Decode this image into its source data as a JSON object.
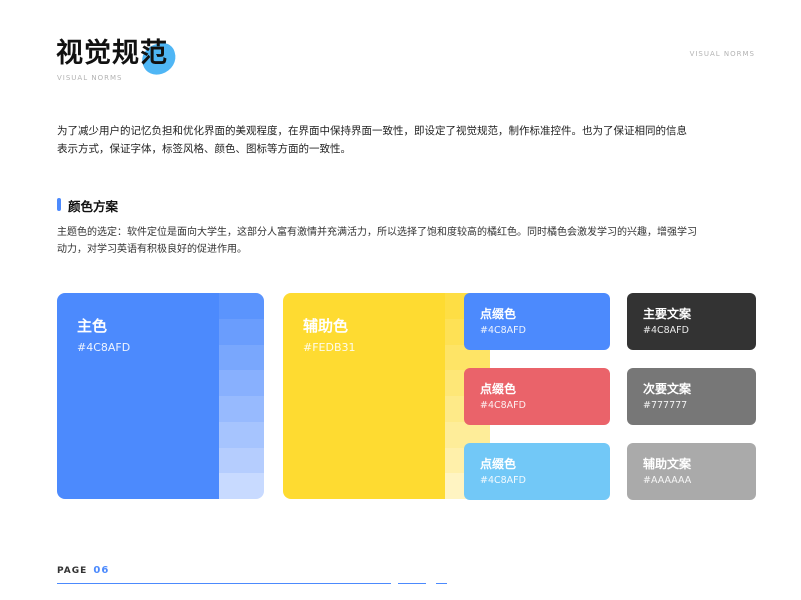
{
  "header": {
    "title": "视觉规范",
    "subtitle_en": "VISUAL NORMS",
    "corner_label": "VISUAL NORMS"
  },
  "intro": "为了减少用户的记忆负担和优化界面的美观程度，在界面中保持界面一致性，即设定了视觉规范，制作标准控件。也为了保证相同的信息表示方式，保证字体，标签风格、颜色、图标等方面的一致性。",
  "section": {
    "title": "颜色方案",
    "description": "主题色的选定：软件定位是面向大学生，这部分人富有激情并充满活力，所以选择了饱和度较高的橘红色。同时橘色会激发学习的兴趣，增强学习动力，对学习英语有积极良好的促进作用。"
  },
  "colors": {
    "primary": {
      "name": "主色",
      "hex": "#4C8AFD",
      "color": "#4c8afd",
      "shades": [
        "#5b94fd",
        "#6a9dfd",
        "#79a7fd",
        "#88b0fe",
        "#97bafe",
        "#a6c4fe",
        "#b5cdfe",
        "#c8daff"
      ]
    },
    "secondary": {
      "name": "辅助色",
      "hex": "#FEDB31",
      "color": "#fedb31",
      "shades": [
        "#fede44",
        "#fee155",
        "#fee466",
        "#fee777",
        "#feea88",
        "#feed99",
        "#fff0aa",
        "#fff4c2"
      ]
    },
    "accents": [
      {
        "name": "点缀色",
        "hex": "#4C8AFD",
        "color": "#4c8afd"
      },
      {
        "name": "点缀色",
        "hex": "#4C8AFD",
        "color": "#ea636a"
      },
      {
        "name": "点缀色",
        "hex": "#4C8AFD",
        "color": "#72c8f7"
      }
    ],
    "text": [
      {
        "name": "主要文案",
        "hex": "#4C8AFD",
        "color": "#333333"
      },
      {
        "name": "次要文案",
        "hex": "#777777",
        "color": "#777777"
      },
      {
        "name": "辅助文案",
        "hex": "#AAAAAA",
        "color": "#aaaaaa"
      }
    ]
  },
  "footer": {
    "page_label": "PAGE",
    "page_number": "06"
  }
}
